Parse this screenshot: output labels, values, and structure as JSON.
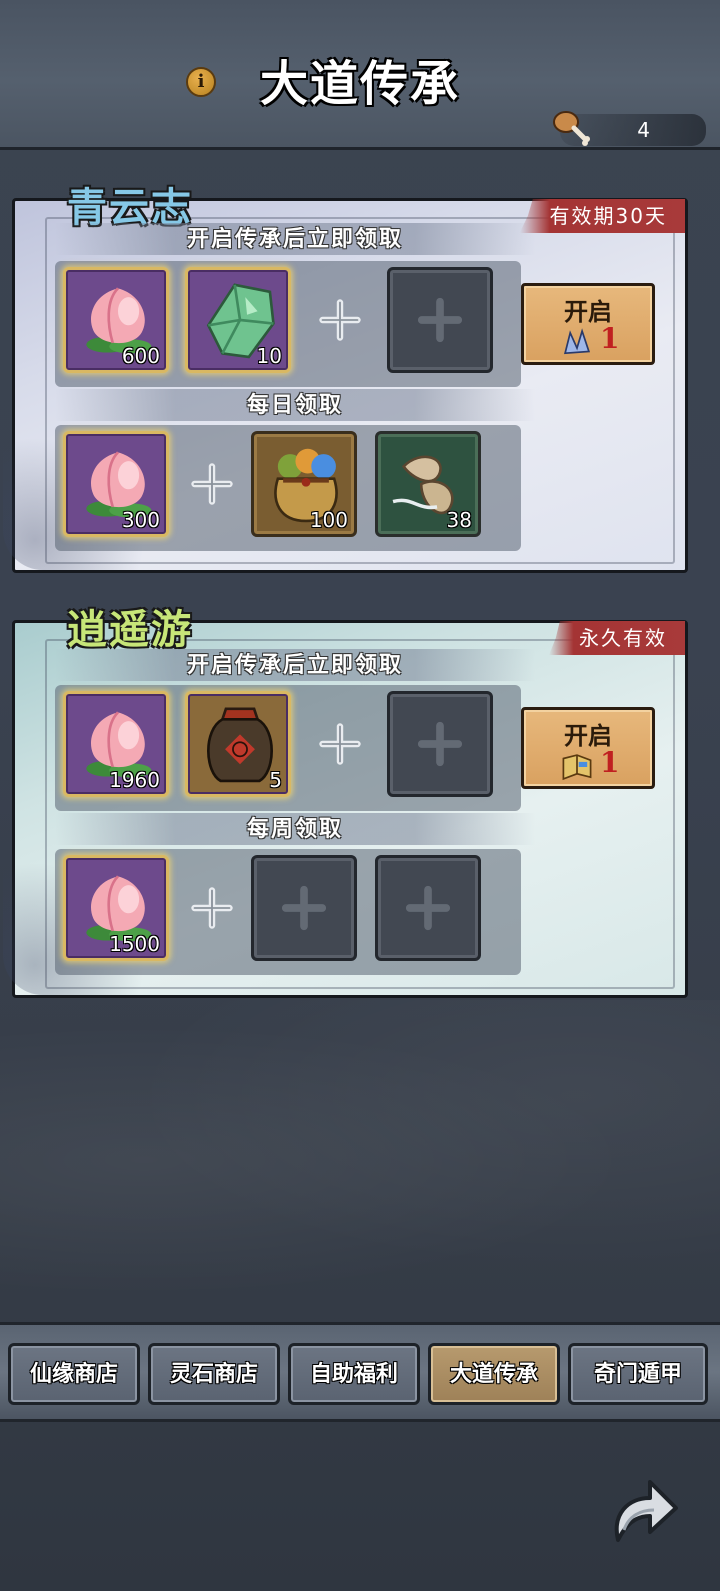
{
  "header": {
    "title": "大道传承",
    "info_icon": "info-icon",
    "info_symbol": "i",
    "currency": {
      "icon": "drumstick-icon",
      "value": "4"
    }
  },
  "packages": [
    {
      "name": "青云志",
      "validity": "有效期30天",
      "instant_label": "开启传承后立即领取",
      "instant_items": [
        {
          "icon": "peach-icon",
          "qty": "600"
        },
        {
          "icon": "jade-crystal-icon",
          "qty": "10"
        }
      ],
      "periodic_label": "每日领取",
      "periodic_items": [
        {
          "icon": "peach-icon",
          "qty": "300"
        },
        {
          "icon": "treasure-bag-icon",
          "qty": "100"
        },
        {
          "icon": "feather-scroll-icon",
          "qty": "38"
        }
      ],
      "button": {
        "label": "开启",
        "cost_icon": "crystal-icon",
        "cost": "1"
      }
    },
    {
      "name": "逍遥游",
      "validity": "永久有效",
      "instant_label": "开启传承后立即领取",
      "instant_items": [
        {
          "icon": "peach-icon",
          "qty": "1960"
        },
        {
          "icon": "wine-jar-icon",
          "qty": "5"
        }
      ],
      "periodic_label": "每周领取",
      "periodic_items": [
        {
          "icon": "peach-icon",
          "qty": "1500"
        }
      ],
      "button": {
        "label": "开启",
        "cost_icon": "book-icon",
        "cost": "1"
      }
    }
  ],
  "tabs": [
    {
      "label": "仙缘商店",
      "active": false
    },
    {
      "label": "灵石商店",
      "active": false
    },
    {
      "label": "自助福利",
      "active": false
    },
    {
      "label": "大道传承",
      "active": true
    },
    {
      "label": "奇门遁甲",
      "active": false
    }
  ],
  "back_button": {
    "icon": "return-arrow-icon"
  },
  "colors": {
    "accent_gold": "#d9b862",
    "validity_red": "#a83a3a",
    "button_orange": "#e0aa6a",
    "title_blue": "#86c8e6",
    "title_green": "#c7e678"
  }
}
